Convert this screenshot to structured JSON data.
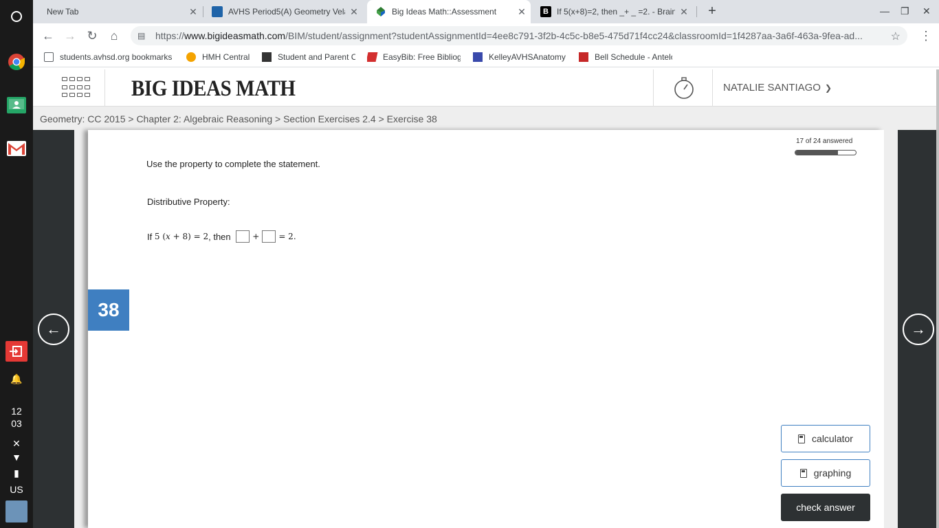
{
  "os": {
    "clock_hour": "12",
    "clock_min": "03",
    "input_lang": "US"
  },
  "tabs": [
    {
      "title": "New Tab",
      "active": false
    },
    {
      "title": "AVHS Period5(A) Geometry Velasco",
      "active": false
    },
    {
      "title": "Big Ideas Math::Assessment",
      "active": true
    },
    {
      "title": "If 5(x+8)=2, then _+ _ =2. - Brainly",
      "active": false
    }
  ],
  "address_bar": {
    "url_prefix": "https://",
    "url_host": "www.bigideasmath.com",
    "url_path": "/BIM/student/assignment?studentAssignmentId=4ee8c791-3f2b-4c5c-b8e5-475d71f4cc24&classroomId=1f4287aa-3a6f-463a-9fea-ad..."
  },
  "bookmarks": [
    "students.avhsd.org bookmarks",
    "HMH Central",
    "Student and Parent C",
    "EasyBib: Free Bibliog",
    "KelleyAVHSAnatomy",
    "Bell Schedule - Antelo"
  ],
  "header": {
    "logo": "BIG IDEAS MATH",
    "user_name": "NATALIE SANTIAGO"
  },
  "breadcrumb": "Geometry: CC 2015 > Chapter 2: Algebraic Reasoning > Section Exercises 2.4 > Exercise 38",
  "progress": {
    "label": "17 of 24 answered",
    "fraction": 0.7
  },
  "question": {
    "instruction": "Use the property to complete the statement.",
    "property": "Distributive Property:",
    "if_text": "If ",
    "expr_coef": "5",
    "expr_open": "(",
    "expr_var": "x",
    "expr_rest": " + 8) = 2",
    "then_text": ", then ",
    "plus": "+",
    "equals": "= 2."
  },
  "exercise_number": "38",
  "tools": {
    "calculator": "calculator",
    "graphing": "graphing",
    "check": "check answer"
  },
  "colors": {
    "accent": "#3f7fc1",
    "dark_panel": "#2d3133"
  },
  "icons": {
    "prev": "←",
    "next": "→"
  }
}
